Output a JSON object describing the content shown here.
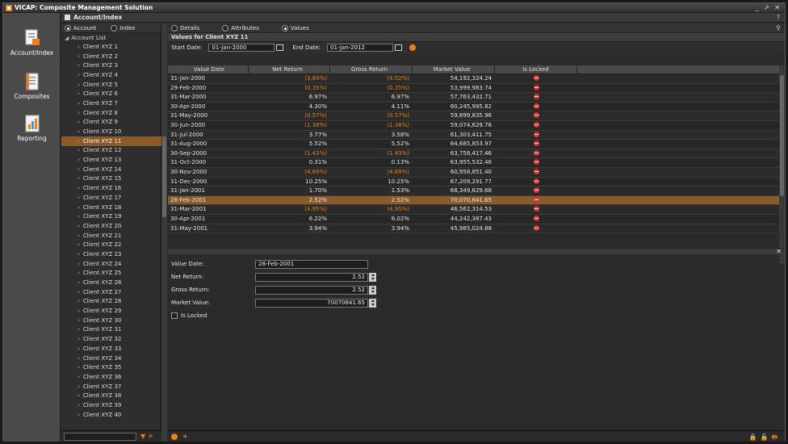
{
  "app": {
    "title": "VICAP: Composite Management Solution",
    "window_controls": "_ ↗ ✕"
  },
  "subbar": {
    "title": "Account/Index",
    "help": "?"
  },
  "nav": [
    {
      "label": "Account/Index",
      "icon": "account-index-icon"
    },
    {
      "label": "Composites",
      "icon": "composites-icon"
    },
    {
      "label": "Reporting",
      "icon": "reporting-icon"
    }
  ],
  "left": {
    "radio_account": "Account",
    "radio_index": "Index",
    "tree_header": "Account List",
    "clients": [
      "Client XYZ 1",
      "Client XYZ 2",
      "Client XYZ 3",
      "Client XYZ 4",
      "Client XYZ 5",
      "Client XYZ 6",
      "Client XYZ 7",
      "Client XYZ 8",
      "Client XYZ 9",
      "Client XYZ 10",
      "Client XYZ 11",
      "Client XYZ 12",
      "Client XYZ 13",
      "Client XYZ 14",
      "Client XYZ 15",
      "Client XYZ 16",
      "Client XYZ 17",
      "Client XYZ 18",
      "Client XYZ 19",
      "Client XYZ 20",
      "Client XYZ 21",
      "Client XYZ 22",
      "Client XYZ 23",
      "Client XYZ 24",
      "Client XYZ 25",
      "Client XYZ 26",
      "Client XYZ 27",
      "Client XYZ 28",
      "Client XYZ 29",
      "Client XYZ 30",
      "Client XYZ 31",
      "Client XYZ 32",
      "Client XYZ 33",
      "Client XYZ 34",
      "Client XYZ 35",
      "Client XYZ 36",
      "Client XYZ 37",
      "Client XYZ 38",
      "Client XYZ 39",
      "Client XYZ 40"
    ],
    "selected_client": "Client XYZ 11"
  },
  "tabs": {
    "details": "Details",
    "attributes": "Attributes",
    "values": "Values",
    "selected": "Values"
  },
  "values": {
    "header": "Values for Client XYZ 11",
    "start_label": "Start Date:",
    "start_date": "01-Jan-2000",
    "end_label": "End Date:",
    "end_date": "01-Jan-2012",
    "columns": [
      "Value Date",
      "Net Return",
      "Gross Return",
      "Market Value",
      "Is Locked"
    ],
    "rows": [
      [
        "31-Jan-2000",
        "(3.84%)",
        "(4.02%)",
        "54,192,324.24"
      ],
      [
        "29-Feb-2000",
        "(0.35%)",
        "(0.35%)",
        "53,999,983.74"
      ],
      [
        "31-Mar-2000",
        "6.97%",
        "6.97%",
        "57,763,432.71"
      ],
      [
        "30-Apr-2000",
        "4.30%",
        "4.11%",
        "60,245,995.82"
      ],
      [
        "31-May-2000",
        "(0.57%)",
        "(0.57%)",
        "59,899,835.96"
      ],
      [
        "30-Jun-2000",
        "(1.38%)",
        "(1.38%)",
        "59,074,629.76"
      ],
      [
        "31-Jul-2000",
        "3.77%",
        "3.58%",
        "61,303,411.75"
      ],
      [
        "31-Aug-2000",
        "5.52%",
        "5.52%",
        "64,685,853.97"
      ],
      [
        "30-Sep-2000",
        "(1.43%)",
        "(1.43%)",
        "63,758,417.46"
      ],
      [
        "31-Oct-2000",
        "0.31%",
        "0.13%",
        "63,955,532.46"
      ],
      [
        "30-Nov-2000",
        "(4.69%)",
        "(4.69%)",
        "60,958,851.40"
      ],
      [
        "31-Dec-2000",
        "10.25%",
        "10.25%",
        "67,209,291.77"
      ],
      [
        "31-Jan-2001",
        "1.70%",
        "1.53%",
        "68,349,629.68"
      ],
      [
        "28-Feb-2001",
        "2.52%",
        "2.52%",
        "70,070,841.65"
      ],
      [
        "31-Mar-2001",
        "(4.95%)",
        "(4.95%)",
        "46,562,314.53"
      ],
      [
        "30-Apr-2001",
        "6.22%",
        "6.02%",
        "44,242,387.43"
      ],
      [
        "31-May-2001",
        "3.94%",
        "3.94%",
        "45,985,024.88"
      ]
    ],
    "selected_row": 13
  },
  "detail": {
    "value_date_label": "Value Date:",
    "value_date": "28-Feb-2001",
    "net_label": "Net Return:",
    "net": "2.52",
    "gross_label": "Gross Return:",
    "gross": "2.52",
    "mv_label": "Market Value:",
    "mv": "70070841.65",
    "locked_label": "Is Locked"
  },
  "footer": {
    "filter_icons": "▼ ✕",
    "lock_icons": "🔒🔓🖶"
  }
}
